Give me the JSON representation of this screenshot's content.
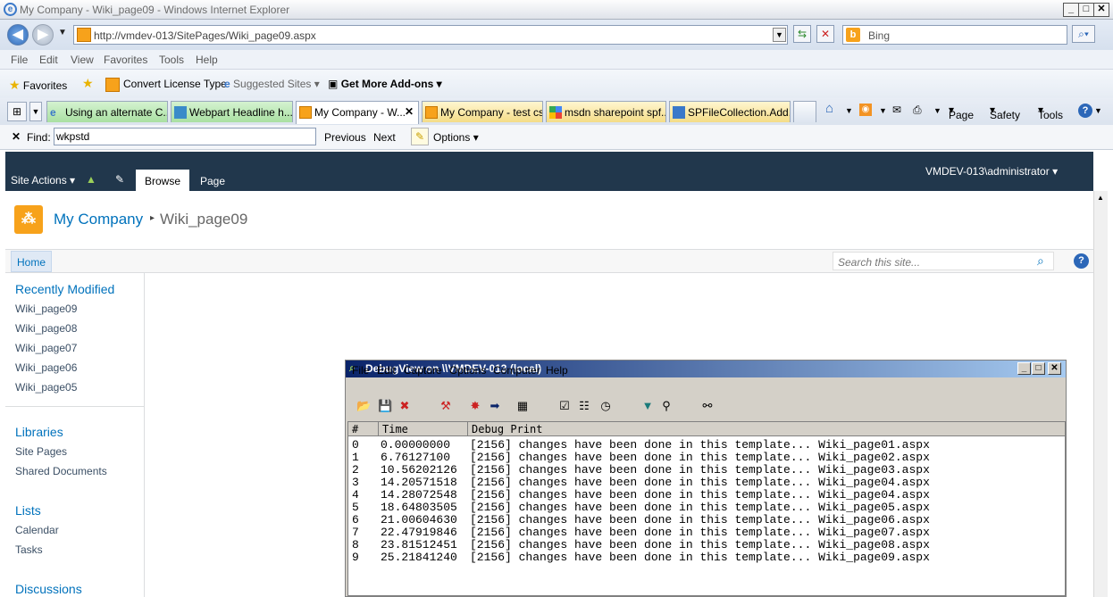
{
  "window": {
    "title": "My Company - Wiki_page09 - Windows Internet Explorer"
  },
  "address": {
    "url": "http://vmdev-013/SitePages/Wiki_page09.aspx",
    "search_placeholder": "Bing"
  },
  "menu": [
    "File",
    "Edit",
    "View",
    "Favorites",
    "Tools",
    "Help"
  ],
  "favorites_bar": {
    "favorites": "Favorites",
    "convert": "Convert License Type",
    "suggested": "Suggested Sites",
    "addons": "Get More Add-ons"
  },
  "tabs": [
    {
      "label": "Using an alternate C..."
    },
    {
      "label": "Webpart Headline h..."
    },
    {
      "label": "My Company - W..."
    },
    {
      "label": "My Company - test css"
    },
    {
      "label": "msdn sharepoint spf..."
    },
    {
      "label": "SPFileCollection.Add..."
    }
  ],
  "commandbar": {
    "page": "Page",
    "safety": "Safety",
    "tools": "Tools"
  },
  "find": {
    "label": "Find:",
    "value": "wkpstd",
    "previous": "Previous",
    "next": "Next",
    "options": "Options"
  },
  "sharepoint": {
    "site_actions": "Site Actions",
    "ribbon_tabs": [
      "Browse",
      "Page"
    ],
    "user": "VMDEV-013\\administrator",
    "site_name": "My Company",
    "page_name": "Wiki_page09",
    "top_nav": "Home",
    "search_placeholder": "Search this site...",
    "quicklaunch": {
      "recently_modified": "Recently Modified",
      "recent": [
        "Wiki_page09",
        "Wiki_page08",
        "Wiki_page07",
        "Wiki_page06",
        "Wiki_page05"
      ],
      "libraries": "Libraries",
      "library_items": [
        "Site Pages",
        "Shared Documents"
      ],
      "lists": "Lists",
      "list_items": [
        "Calendar",
        "Tasks"
      ],
      "discussions": "Discussions"
    }
  },
  "debugview": {
    "title": "DebugView on \\\\VMDEV-013 (local)",
    "menu": [
      "File",
      "Edit",
      "Capture",
      "Options",
      "Computer",
      "Help"
    ],
    "columns": [
      "#",
      "Time",
      "Debug Print"
    ],
    "rows": [
      {
        "n": "0",
        "time": "0.00000000",
        "msg": "[2156] changes have been done in this template... Wiki_page01.aspx"
      },
      {
        "n": "1",
        "time": "6.76127100",
        "msg": "[2156] changes have been done in this template... Wiki_page02.aspx"
      },
      {
        "n": "2",
        "time": "10.56202126",
        "msg": "[2156] changes have been done in this template... Wiki_page03.aspx"
      },
      {
        "n": "3",
        "time": "14.20571518",
        "msg": "[2156] changes have been done in this template... Wiki_page04.aspx"
      },
      {
        "n": "4",
        "time": "14.28072548",
        "msg": "[2156] changes have been done in this template... Wiki_page04.aspx"
      },
      {
        "n": "5",
        "time": "18.64803505",
        "msg": "[2156] changes have been done in this template... Wiki_page05.aspx"
      },
      {
        "n": "6",
        "time": "21.00604630",
        "msg": "[2156] changes have been done in this template... Wiki_page06.aspx"
      },
      {
        "n": "7",
        "time": "22.47919846",
        "msg": "[2156] changes have been done in this template... Wiki_page07.aspx"
      },
      {
        "n": "8",
        "time": "23.81512451",
        "msg": "[2156] changes have been done in this template... Wiki_page08.aspx"
      },
      {
        "n": "9",
        "time": "25.21841240",
        "msg": "[2156] changes have been done in this template... Wiki_page09.aspx"
      }
    ]
  }
}
